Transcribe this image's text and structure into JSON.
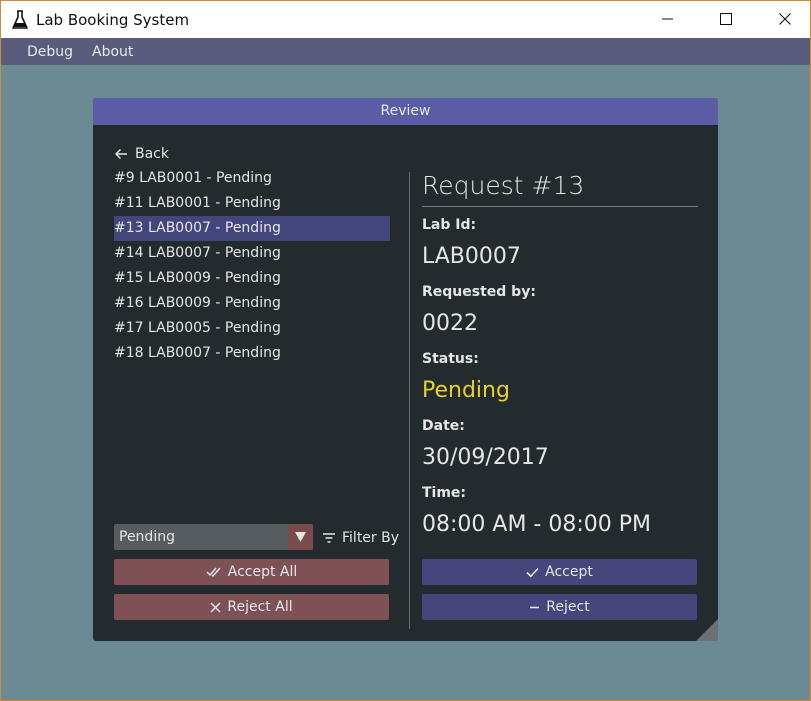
{
  "window": {
    "title": "Lab Booking System"
  },
  "menu": {
    "items": [
      "Debug",
      "About"
    ]
  },
  "panel": {
    "title": "Review"
  },
  "list": {
    "back_label": "Back",
    "items": [
      "#9 LAB0001 - Pending",
      "#11 LAB0001 - Pending",
      "#13 LAB0007 - Pending",
      "#14 LAB0007 - Pending",
      "#15 LAB0009 - Pending",
      "#16 LAB0009 - Pending",
      "#17 LAB0005 - Pending",
      "#18 LAB0007 - Pending"
    ],
    "selected_index": 2
  },
  "filter": {
    "selected": "Pending",
    "filter_label": "Filter By"
  },
  "actions": {
    "accept_all": "Accept All",
    "reject_all": "Reject All",
    "accept": "Accept",
    "reject": "Reject"
  },
  "detail": {
    "title": "Request #13",
    "lab_id_label": "Lab Id:",
    "lab_id": "LAB0007",
    "requested_by_label": "Requested by:",
    "requested_by": "0022",
    "status_label": "Status:",
    "status": "Pending",
    "date_label": "Date:",
    "date": "30/09/2017",
    "time_label": "Time:",
    "time": "08:00 AM - 08:00 PM"
  },
  "colors": {
    "background": "#6c8a94",
    "menubar": "#5a5c7e",
    "panel": "#232b2f",
    "panel_header": "#5b5ca6",
    "selected_row": "#43467c",
    "danger_button": "#7e5254",
    "primary_button": "#45477c",
    "status_pending": "#e8cf2a"
  },
  "icons": [
    "flask-icon",
    "minimize-icon",
    "maximize-icon",
    "close-icon",
    "arrow-left-icon",
    "filter-icon",
    "double-check-icon",
    "x-icon",
    "check-icon",
    "minus-icon",
    "dropdown-arrow-icon"
  ]
}
